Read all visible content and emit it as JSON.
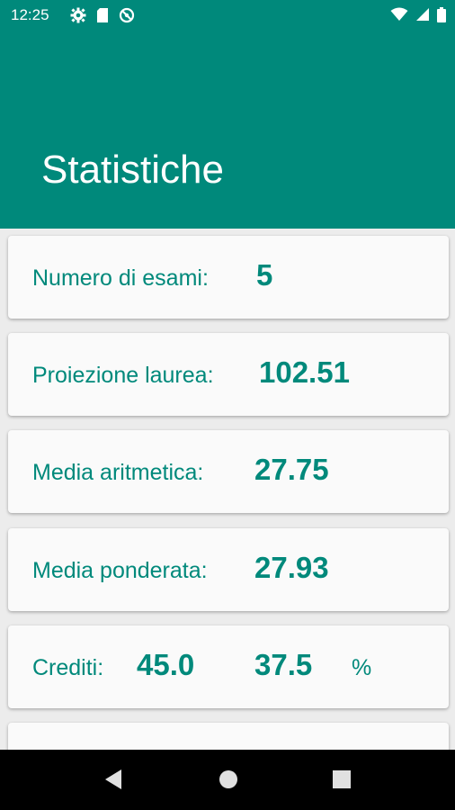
{
  "status_bar": {
    "time": "12:25",
    "left_icons": [
      "settings-icon",
      "sd-card-icon",
      "no-sync-icon"
    ],
    "right_icons": [
      "wifi-icon",
      "signal-icon",
      "battery-icon"
    ]
  },
  "app_bar": {
    "title": "Statistiche",
    "color": "#00897b"
  },
  "stats": {
    "exams": {
      "label": "Numero di esami:",
      "value": "5"
    },
    "projection": {
      "label": "Proiezione laurea:",
      "value": "102.51"
    },
    "arithmetic": {
      "label": "Media aritmetica:",
      "value": "27.75"
    },
    "weighted": {
      "label": "Media ponderata:",
      "value": "27.93"
    },
    "credits": {
      "label": "Crediti:",
      "value": "45.0",
      "percent_value": "37.5",
      "percent_sign": "%"
    }
  },
  "nav_bar": {
    "buttons": [
      "back-icon",
      "home-icon",
      "recents-icon"
    ]
  }
}
